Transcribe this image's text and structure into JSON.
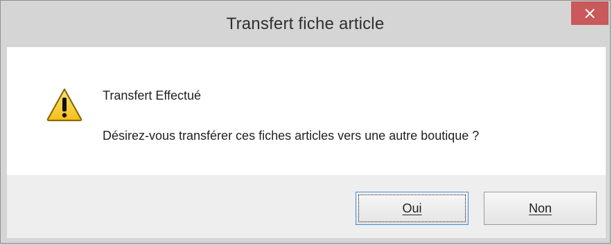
{
  "window": {
    "title": "Transfert fiche article",
    "close_glyph": "×",
    "close_color": "#C9595B"
  },
  "dialog": {
    "icon": "warning-icon",
    "heading": "Transfert Effectué",
    "message": "Désirez-vous transférer ces fiches articles vers une autre boutique ?"
  },
  "buttons": {
    "yes_label": "Oui",
    "no_label": "Non"
  }
}
